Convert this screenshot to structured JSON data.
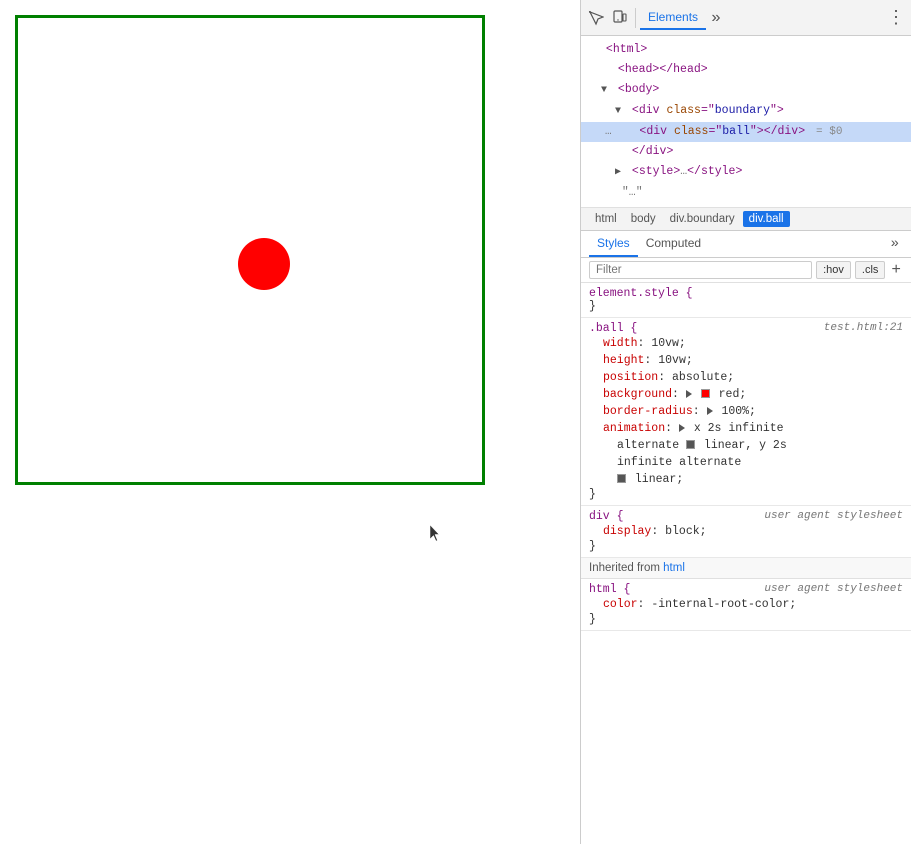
{
  "preview": {
    "boundary_label": "boundary div",
    "ball_label": "ball div"
  },
  "devtools": {
    "toolbar": {
      "inspect_icon": "⊹",
      "device_icon": "⬜",
      "elements_tab": "Elements",
      "more_tabs_icon": "»",
      "menu_icon": "⋮"
    },
    "dom_tree": {
      "lines": [
        {
          "indent": 0,
          "content": "<html>",
          "type": "tag"
        },
        {
          "indent": 1,
          "content": "<head></head>",
          "type": "tag"
        },
        {
          "indent": 1,
          "content": "<body>",
          "type": "tag",
          "arrow": "▼"
        },
        {
          "indent": 2,
          "content": "<div class=\"boundary\">",
          "type": "tag",
          "arrow": "▼"
        },
        {
          "indent": 3,
          "content": "<div class=\"ball\"></div>",
          "type": "tag-selected",
          "ellipsis": "..."
        },
        {
          "indent": 3,
          "content": "</div>",
          "type": "tag"
        },
        {
          "indent": 2,
          "content": "<style>…</style>",
          "type": "tag",
          "arrow": "▶"
        },
        {
          "indent": 2,
          "content": "\"...\"",
          "type": "text"
        }
      ]
    },
    "breadcrumb": {
      "items": [
        {
          "label": "html",
          "active": false
        },
        {
          "label": "body",
          "active": false
        },
        {
          "label": "div.boundary",
          "active": false
        },
        {
          "label": "div.ball",
          "active": true
        }
      ]
    },
    "styles_tabs": {
      "tabs": [
        "Styles",
        "Computed"
      ],
      "active": "Styles",
      "more_icon": "»"
    },
    "filter": {
      "placeholder": "Filter",
      "hov_btn": ":hov",
      "cls_btn": ".cls",
      "plus_btn": "+"
    },
    "css_rules": [
      {
        "selector": "element.style {",
        "source": "",
        "properties": [],
        "close": "}"
      },
      {
        "selector": ".ball {",
        "source": "test.html:21",
        "properties": [
          {
            "name": "width",
            "value": "10vw;",
            "color": null
          },
          {
            "name": "height",
            "value": "10vw;",
            "color": null
          },
          {
            "name": "position",
            "value": "absolute;",
            "color": null
          },
          {
            "name": "background",
            "value": "red;",
            "color": "red",
            "has_swatch": true,
            "has_triangle": true
          },
          {
            "name": "border-radius",
            "value": "100%;",
            "has_triangle": true
          },
          {
            "name": "animation",
            "value": "x 2s infinite",
            "has_triangle": true
          }
        ],
        "animation_extra": "    alternate ⬛linear, y 2s\n    infinite alternate\n    ⬛linear;",
        "close": "}"
      },
      {
        "selector": "div {",
        "source": "user agent stylesheet",
        "source_italic": true,
        "properties": [
          {
            "name": "display",
            "value": "block;",
            "color": null
          }
        ],
        "close": "}"
      }
    ],
    "inherited": {
      "label": "Inherited from",
      "link": "html"
    },
    "html_rule": {
      "selector": "html {",
      "source": "user agent stylesheet",
      "source_italic": true,
      "properties": [
        {
          "name": "color",
          "value": "-internal-root-color;"
        }
      ],
      "close": "}"
    }
  }
}
